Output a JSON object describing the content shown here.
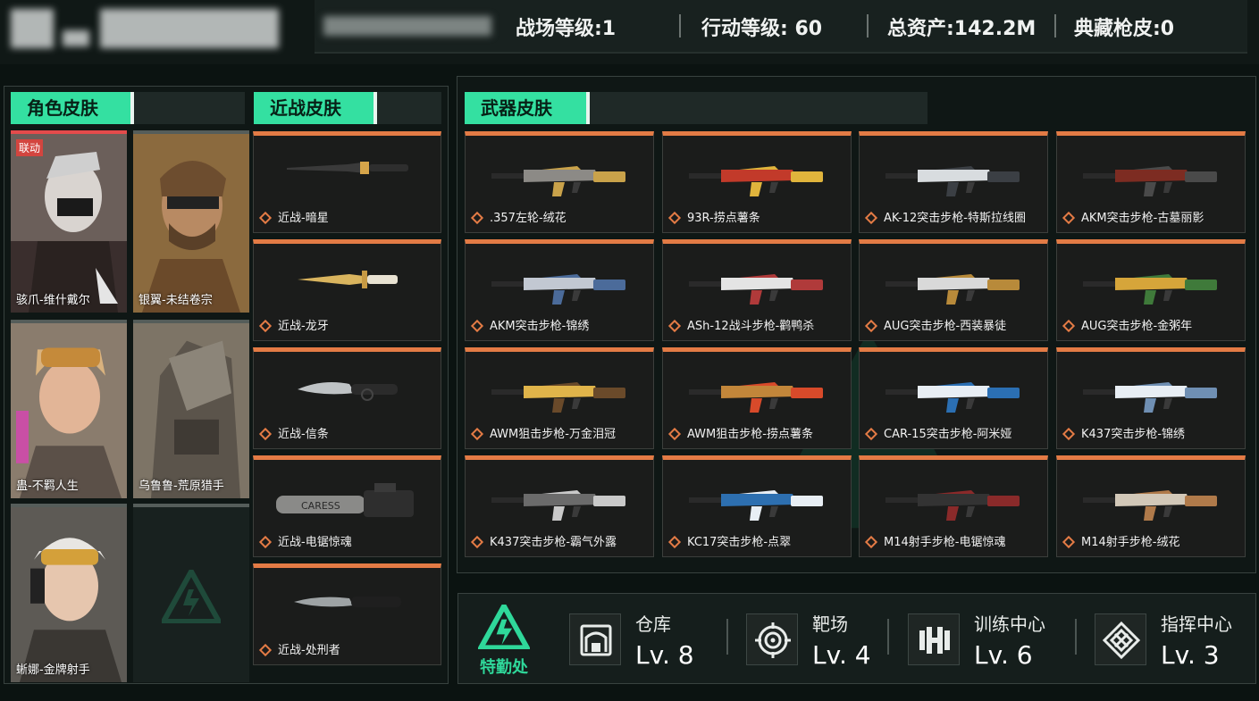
{
  "topbar": {
    "stats": [
      {
        "label": "战场等级:1"
      },
      {
        "label": "行动等级: 60"
      },
      {
        "label": "总资产:142.2M"
      },
      {
        "label": "典藏枪皮:0"
      }
    ]
  },
  "sections": {
    "character": "角色皮肤",
    "melee": "近战皮肤",
    "weapon": "武器皮肤"
  },
  "characters": [
    {
      "name": "骇爪-维什戴尔",
      "badge": "联动"
    },
    {
      "name": "银翼-未结卷宗"
    },
    {
      "name": "蛊-不羁人生"
    },
    {
      "name": "乌鲁鲁-荒原猎手"
    },
    {
      "name": "蜥娜-金牌射手"
    }
  ],
  "melee": [
    {
      "name": "近战-暗星"
    },
    {
      "name": "近战-龙牙"
    },
    {
      "name": "近战-信条"
    },
    {
      "name": "近战-电锯惊魂"
    },
    {
      "name": "近战-处刑者"
    }
  ],
  "weapons": [
    {
      "name": ".357左轮-绒花"
    },
    {
      "name": "93R-捞点薯条"
    },
    {
      "name": "AK-12突击步枪-特斯拉线圈"
    },
    {
      "name": "AKM突击步枪-古墓丽影"
    },
    {
      "name": "AKM突击步枪-锦绣"
    },
    {
      "name": "ASh-12战斗步枪-鹳鸭杀"
    },
    {
      "name": "AUG突击步枪-西装暴徒"
    },
    {
      "name": "AUG突击步枪-金粥年"
    },
    {
      "name": "AWM狙击步枪-万金泪冠"
    },
    {
      "name": "AWM狙击步枪-捞点薯条"
    },
    {
      "name": "CAR-15突击步枪-阿米娅"
    },
    {
      "name": "K437突击步枪-锦绣"
    },
    {
      "name": "K437突击步枪-霸气外露"
    },
    {
      "name": "KC17突击步枪-点翠"
    },
    {
      "name": "M14射手步枪-电锯惊魂"
    },
    {
      "name": "M14射手步枪-绒花"
    }
  ],
  "facilities": {
    "logo_label": "特勤处",
    "items": [
      {
        "name": "仓库",
        "level": "Lv. 8",
        "icon": "warehouse-icon"
      },
      {
        "name": "靶场",
        "level": "Lv. 4",
        "icon": "target-icon"
      },
      {
        "name": "训练中心",
        "level": "Lv. 6",
        "icon": "dumbbell-icon"
      },
      {
        "name": "指挥中心",
        "level": "Lv. 3",
        "icon": "command-icon"
      }
    ]
  },
  "colors": {
    "accent": "#34e0a1",
    "item_strip": "#e37b45",
    "collab_badge": "#d3453f"
  }
}
